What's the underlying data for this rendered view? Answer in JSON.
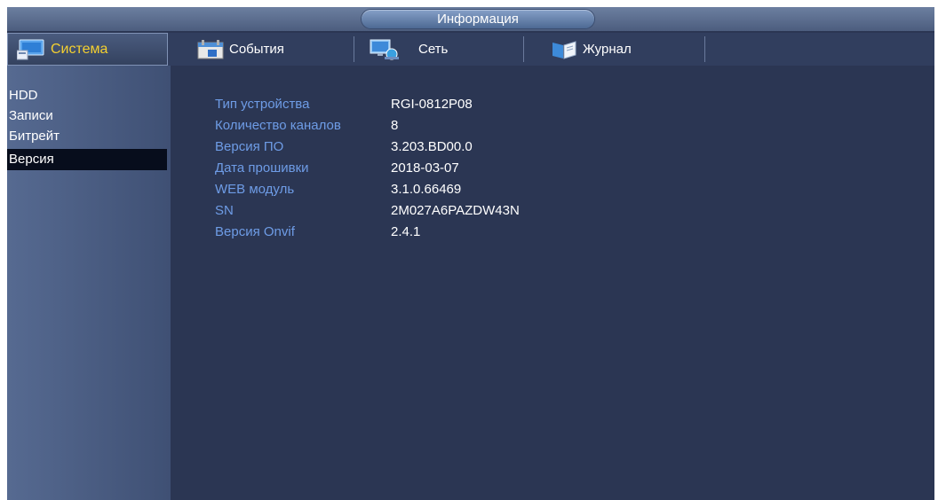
{
  "header": {
    "title": "Информация"
  },
  "tabs": [
    {
      "label": "Система",
      "icon": "monitor-icon",
      "active": true
    },
    {
      "label": "События",
      "icon": "calendar-icon"
    },
    {
      "label": "Сеть",
      "icon": "network-icon"
    },
    {
      "label": "Журнал",
      "icon": "book-icon"
    }
  ],
  "sidebar": {
    "items": [
      {
        "label": "HDD"
      },
      {
        "label": "Записи"
      },
      {
        "label": "Битрейт"
      },
      {
        "label": "Версия",
        "active": true
      }
    ]
  },
  "info": {
    "rows": [
      {
        "key": "Тип устройства",
        "value": "RGI-0812P08"
      },
      {
        "key": "Количество каналов",
        "value": "8"
      },
      {
        "key": "Версия ПО",
        "value": "3.203.BD00.0"
      },
      {
        "key": "Дата прошивки",
        "value": "2018-03-07"
      },
      {
        "key": "WEB модуль",
        "value": "3.1.0.66469"
      },
      {
        "key": "SN",
        "value": "2M027A6PAZDW43N"
      },
      {
        "key": "Версия Onvif",
        "value": "2.4.1"
      }
    ]
  },
  "colors": {
    "active_tab_text": "#f4d030",
    "label_blue": "#6e9ce6",
    "background": "#2b3653"
  }
}
